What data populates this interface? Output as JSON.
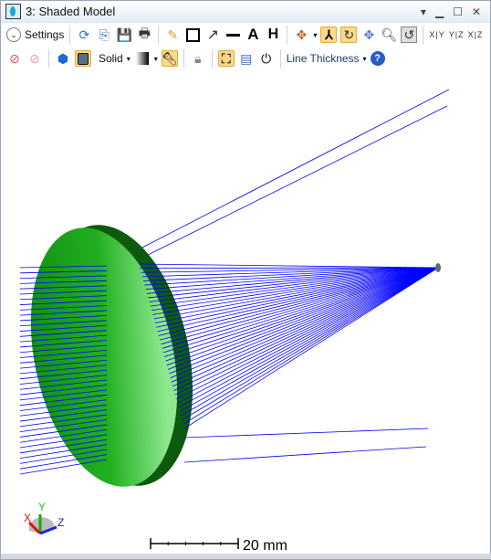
{
  "window": {
    "title": "3: Shaded Model",
    "controls": [
      "dropdown-icon",
      "minimize-icon",
      "maximize-icon",
      "close-icon"
    ]
  },
  "toolbar1": {
    "settings_label": "Settings",
    "view_labels": [
      "X|Y",
      "Y|Z",
      "X|Z"
    ]
  },
  "toolbar2": {
    "render_mode": "Solid",
    "line_thickness_label": "Line Thickness"
  },
  "viewport": {
    "axis_labels": {
      "x": "X",
      "y": "Y",
      "z": "Z"
    },
    "scale_bar_label": "20 mm",
    "colors": {
      "lens": "#1a9a1a",
      "rays": "#0000ff"
    }
  }
}
